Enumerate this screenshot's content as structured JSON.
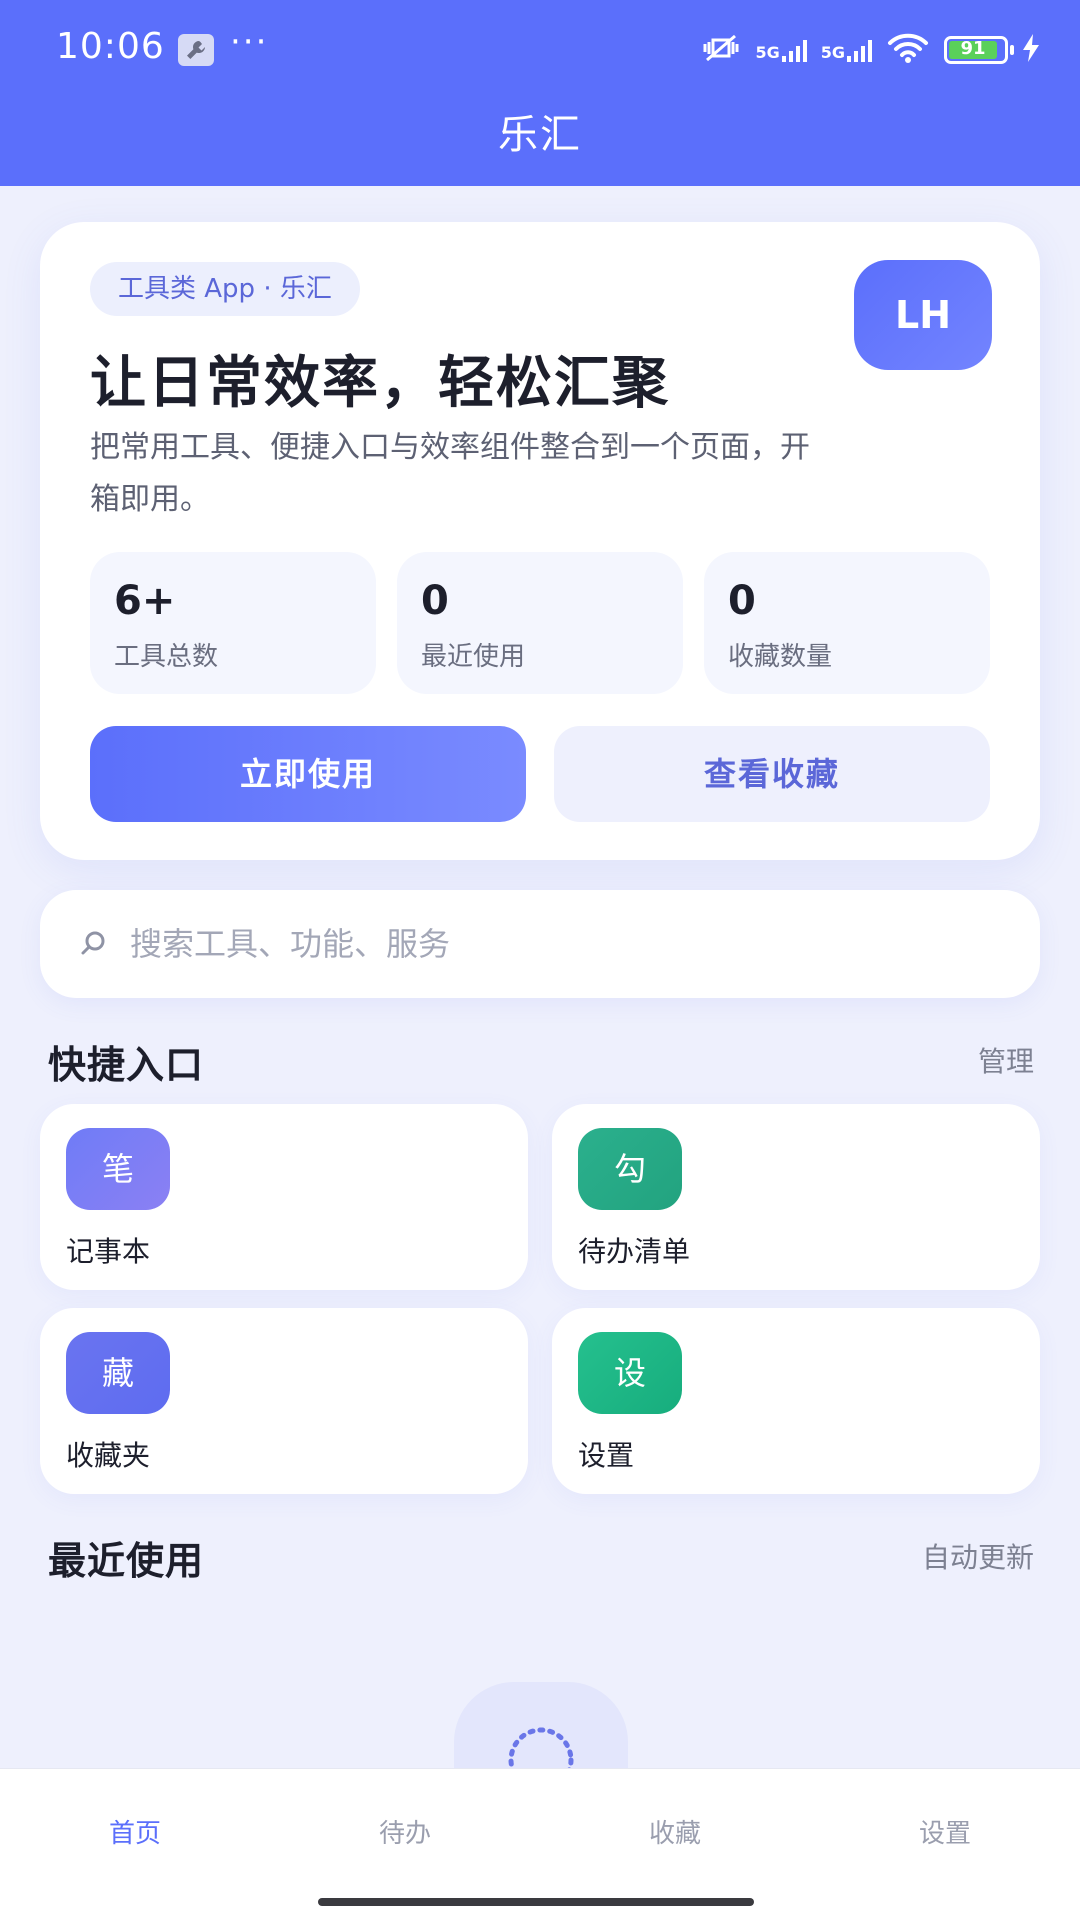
{
  "status_bar": {
    "time": "10:06",
    "more": "···",
    "network_1": "5G",
    "network_2": "5G",
    "battery": "91"
  },
  "app_bar": {
    "title": "乐汇"
  },
  "hero": {
    "tag": "工具类 App · 乐汇",
    "avatar": "LH",
    "title": "让日常效率，轻松汇聚",
    "description": "把常用工具、便捷入口与效率组件整合到一个页面，开箱即用。",
    "stats": [
      {
        "value": "6+",
        "label": "工具总数"
      },
      {
        "value": "0",
        "label": "最近使用"
      },
      {
        "value": "0",
        "label": "收藏数量"
      }
    ],
    "primary_button": "立即使用",
    "secondary_button": "查看收藏"
  },
  "search": {
    "placeholder": "搜索工具、功能、服务"
  },
  "quick_entry": {
    "title": "快捷入口",
    "action": "管理",
    "items": [
      {
        "icon": "笔",
        "label": "记事本",
        "color": "#7b7ff5"
      },
      {
        "icon": "勾",
        "label": "待办清单",
        "color": "#25b28a"
      },
      {
        "icon": "藏",
        "label": "收藏夹",
        "color": "#6a74f0"
      },
      {
        "icon": "设",
        "label": "设置",
        "color": "#1fb887"
      }
    ]
  },
  "recent": {
    "title": "最近使用",
    "action": "自动更新"
  },
  "bottom_nav": {
    "items": [
      {
        "label": "首页",
        "active": true
      },
      {
        "label": "待办",
        "active": false
      },
      {
        "label": "收藏",
        "active": false
      },
      {
        "label": "设置",
        "active": false
      }
    ]
  },
  "colors": {
    "accent": "#5b6ffb",
    "background": "#eef0fd"
  }
}
